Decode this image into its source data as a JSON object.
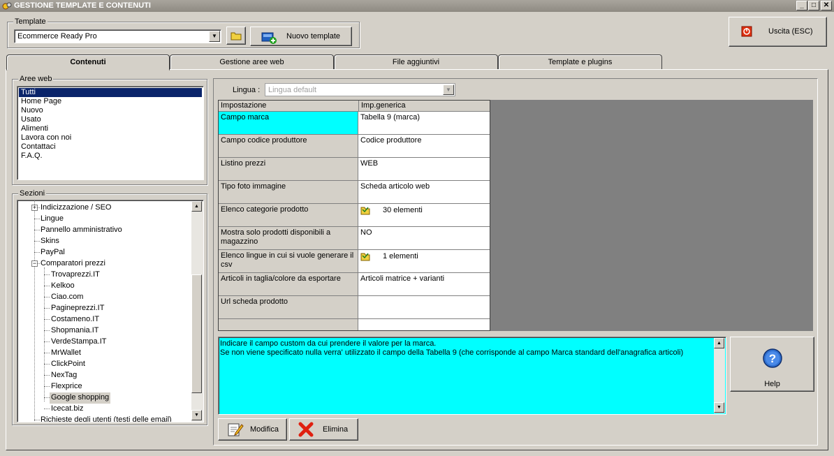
{
  "window": {
    "title": "GESTIONE TEMPLATE E CONTENUTI",
    "min": "_",
    "max": "□",
    "close": "✕"
  },
  "template": {
    "group_label": "Template",
    "selected": "Ecommerce Ready Pro",
    "new_button": "Nuovo template"
  },
  "exit_button": "Uscita (ESC)",
  "tabs": [
    {
      "label": "Contenuti",
      "active": true
    },
    {
      "label": "Gestione aree web"
    },
    {
      "label": "File aggiuntivi"
    },
    {
      "label": "Template e plugins"
    }
  ],
  "aree_web": {
    "label": "Aree web",
    "items": [
      "Tutti",
      "Home Page",
      "Nuovo",
      "Usato",
      "Alimenti",
      "Lavora con noi",
      "Contattaci",
      "F.A.Q."
    ],
    "selected_index": 0
  },
  "sezioni": {
    "label": "Sezioni",
    "nodes": [
      {
        "text": "Indicizzazione / SEO",
        "level": 0,
        "expander": "+"
      },
      {
        "text": "Lingue",
        "level": 0
      },
      {
        "text": "Pannello amministrativo",
        "level": 0
      },
      {
        "text": "Skins",
        "level": 0
      },
      {
        "text": "PayPal",
        "level": 0
      },
      {
        "text": "Comparatori prezzi",
        "level": 0,
        "expander": "−"
      },
      {
        "text": "Trovaprezzi.IT",
        "level": 1
      },
      {
        "text": "Kelkoo",
        "level": 1
      },
      {
        "text": "Ciao.com",
        "level": 1
      },
      {
        "text": "Pagineprezzi.IT",
        "level": 1
      },
      {
        "text": "Costameno.IT",
        "level": 1
      },
      {
        "text": "Shopmania.IT",
        "level": 1
      },
      {
        "text": "VerdeStampa.IT",
        "level": 1
      },
      {
        "text": "MrWallet",
        "level": 1
      },
      {
        "text": "ClickPoint",
        "level": 1
      },
      {
        "text": "NexTag",
        "level": 1
      },
      {
        "text": "Flexprice",
        "level": 1
      },
      {
        "text": "Google shopping",
        "level": 1,
        "selected": true
      },
      {
        "text": "Icecat.biz",
        "level": 1
      },
      {
        "text": "Richieste degli utenti (testi delle email)",
        "level": 0
      }
    ]
  },
  "lingua": {
    "label": "Lingua :",
    "value": "Lingua default"
  },
  "grid": {
    "headers": [
      "Impostazione",
      "Imp.generica"
    ],
    "rows": [
      {
        "name": "Campo marca",
        "value": "Tabella 9 (marca)",
        "selected": true
      },
      {
        "name": "Campo codice produttore",
        "value": "Codice produttore"
      },
      {
        "name": "Listino prezzi",
        "value": "WEB"
      },
      {
        "name": "Tipo foto immagine",
        "value": "Scheda articolo web"
      },
      {
        "name": "Elenco categorie prodotto",
        "value": "30 elementi",
        "icon": "folder-icon"
      },
      {
        "name": "Mostra solo prodotti disponibili a magazzino",
        "value": "NO"
      },
      {
        "name": "Elenco lingue in cui si vuole generare il csv",
        "value": "1 elementi",
        "icon": "folder-icon"
      },
      {
        "name": "Articoli in taglia/colore da esportare",
        "value": "Articoli matrice + varianti"
      },
      {
        "name": "Url scheda prodotto",
        "value": ""
      },
      {
        "name": "",
        "value": ""
      }
    ]
  },
  "description": {
    "line1": "Indicare il campo custom da cui prendere il valore per la marca.",
    "line2": "Se non viene specificato nulla verra' utilizzato il campo della Tabella 9 (che corrisponde al campo Marca standard dell'anagrafica articoli)"
  },
  "help_button": "Help",
  "modifica_button": "Modifica",
  "elimina_button": "Elimina",
  "colors": {
    "selection": "#0a246a",
    "highlight": "#00ffff",
    "grey_area": "#808080"
  }
}
